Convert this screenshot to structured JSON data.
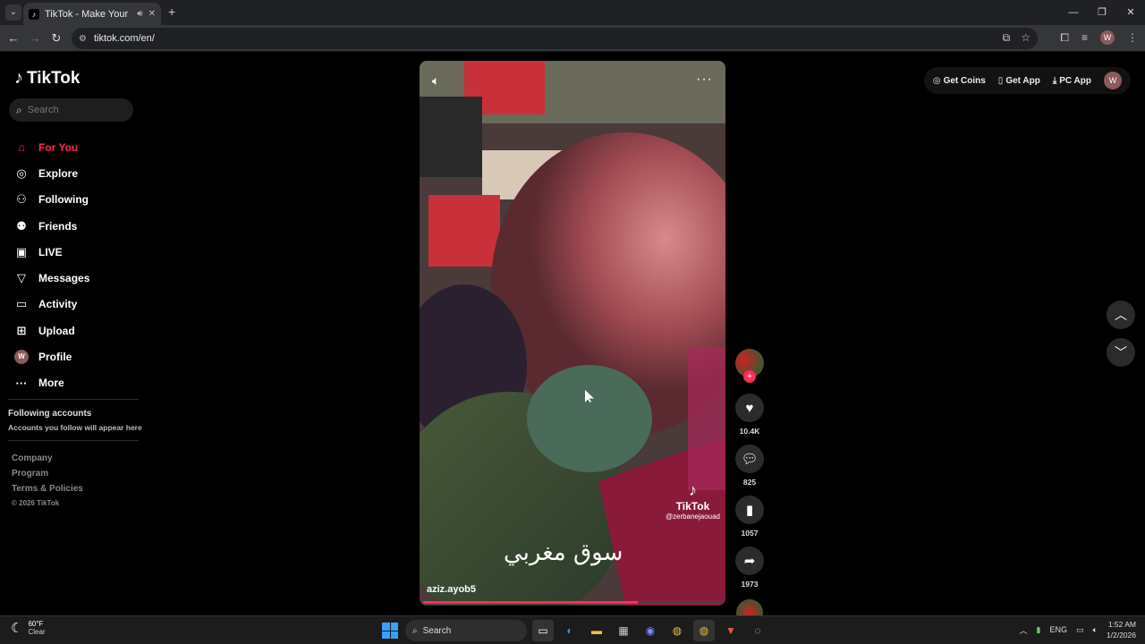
{
  "browser": {
    "tab_title": "TikTok - Make Your Day",
    "url": "tiktok.com/en/",
    "profile_initial": "W"
  },
  "tiktok": {
    "logo_text": "TikTok",
    "search_placeholder": "Search",
    "nav": [
      {
        "label": "For You",
        "icon": "home-icon",
        "active": true
      },
      {
        "label": "Explore",
        "icon": "compass-icon",
        "active": false
      },
      {
        "label": "Following",
        "icon": "user-follow-icon",
        "active": false
      },
      {
        "label": "Friends",
        "icon": "friends-icon",
        "active": false
      },
      {
        "label": "LIVE",
        "icon": "live-icon",
        "active": false
      },
      {
        "label": "Messages",
        "icon": "messages-icon",
        "active": false
      },
      {
        "label": "Activity",
        "icon": "activity-icon",
        "active": false
      },
      {
        "label": "Upload",
        "icon": "upload-icon",
        "active": false
      },
      {
        "label": "Profile",
        "icon": "avatar",
        "active": false
      },
      {
        "label": "More",
        "icon": "more-icon",
        "active": false
      }
    ],
    "following_title": "Following accounts",
    "following_sub": "Accounts you follow will appear here",
    "footer": {
      "company": "Company",
      "program": "Program",
      "terms": "Terms & Policies",
      "copyright": "© 2026 TikTok"
    },
    "topbar": {
      "get_coins": "Get Coins",
      "get_app": "Get App",
      "pc_app": "PC App",
      "avatar_initial": "W"
    },
    "video": {
      "caption": "سوق مغربي",
      "author": "aziz.ayob5",
      "watermark_logo": "TikTok",
      "watermark_user": "@zerbanejaouad",
      "progress": 0.72
    },
    "actions": {
      "likes": "10.4K",
      "comments": "825",
      "saves": "1057",
      "shares": "1973"
    },
    "accent": "#fe2c55"
  },
  "taskbar": {
    "weather_temp": "60°F",
    "weather_cond": "Clear",
    "search_label": "Search",
    "lang": "ENG",
    "time": "1:52 AM",
    "date": "1/2/2026"
  }
}
